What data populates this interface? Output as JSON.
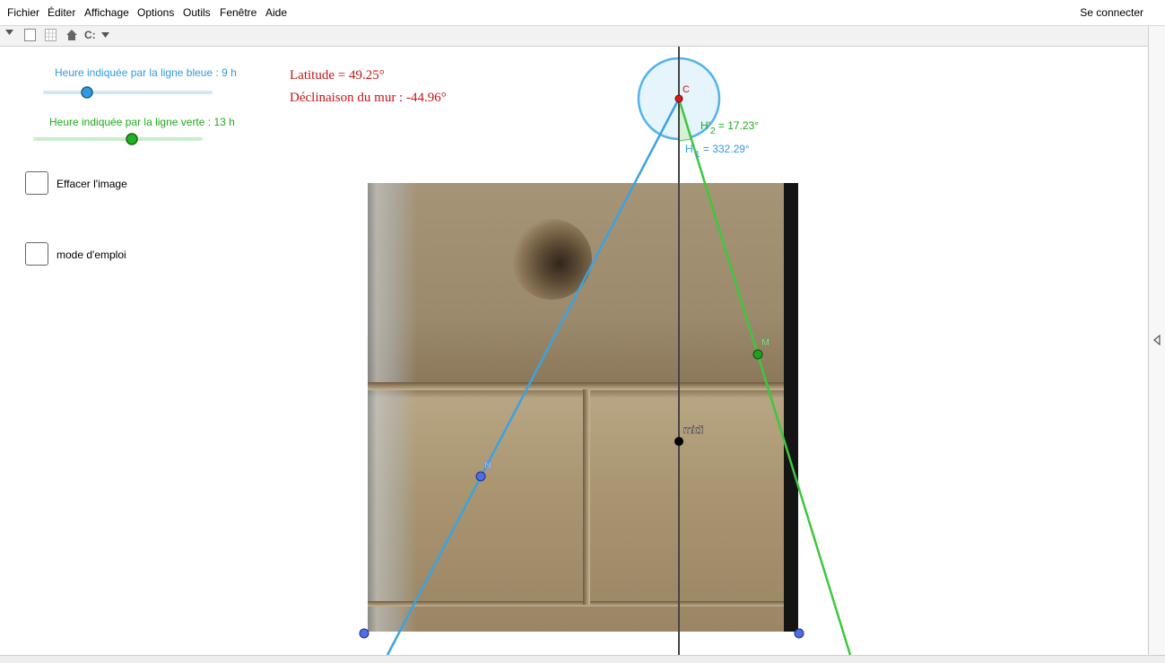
{
  "menu": {
    "items": [
      "Fichier",
      "Éditer",
      "Affichage",
      "Options",
      "Outils",
      "Fenêtre",
      "Aide"
    ],
    "login": "Se connecter"
  },
  "toolbar": {
    "icons": [
      "triangle-down-icon",
      "blank-page-icon",
      "grid-icon",
      "home-icon",
      "cursor-select-icon",
      "chevron-down-icon"
    ]
  },
  "sliders": {
    "blue": {
      "label": "Heure indiquée par la ligne bleue : 9 h",
      "value": 9,
      "color": "#2f9ae0"
    },
    "green": {
      "label": "Heure indiquée par la ligne verte : 13 h",
      "value": 13,
      "color": "#1eab1e"
    }
  },
  "checkboxes": {
    "erase_image": {
      "label": "Effacer l'image",
      "checked": false
    },
    "manual": {
      "label": "mode d'emploi",
      "checked": false
    }
  },
  "info": {
    "latitude": "Latitude = 49.25°",
    "declination": "Déclinaison du mur : -44.96°"
  },
  "angles": {
    "h2": {
      "text": "H'2 = 17.23°",
      "prefix": "H'",
      "sub": "2",
      "value": " = 17.23°"
    },
    "h1": {
      "text": "H'1 = 332.29°",
      "prefix": "H'",
      "sub": "1",
      "value": " = 332.29°"
    }
  },
  "points": {
    "c": "C",
    "m": "M",
    "n": "N",
    "midi": "midi"
  },
  "colors": {
    "blue_line": "#3aa3e0",
    "green_line": "#3cc83c",
    "red_text": "#c61414",
    "point_blue": "#4d6ee8",
    "point_green": "#21a121",
    "point_red": "#d41e1e"
  }
}
